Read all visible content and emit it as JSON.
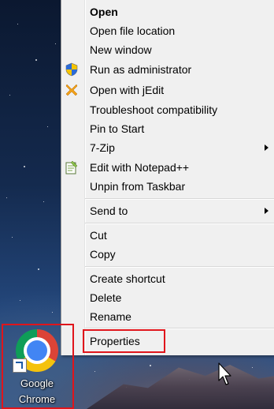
{
  "context_menu": {
    "items": [
      {
        "label": "Open",
        "bold": true,
        "icon": null,
        "submenu": false
      },
      {
        "label": "Open file location",
        "icon": null,
        "submenu": false
      },
      {
        "label": "New window",
        "icon": null,
        "submenu": false
      },
      {
        "label": "Run as administrator",
        "icon": "uac-shield-icon",
        "submenu": false
      },
      {
        "label": "Open with jEdit",
        "icon": "jedit-icon",
        "submenu": false
      },
      {
        "label": "Troubleshoot compatibility",
        "icon": null,
        "submenu": false
      },
      {
        "label": "Pin to Start",
        "icon": null,
        "submenu": false
      },
      {
        "label": "7-Zip",
        "icon": null,
        "submenu": true
      },
      {
        "label": "Edit with Notepad++",
        "icon": "notepad-plus-plus-icon",
        "submenu": false
      },
      {
        "label": "Unpin from Taskbar",
        "icon": null,
        "submenu": false
      },
      {
        "label": "Send to",
        "icon": null,
        "submenu": true
      },
      {
        "label": "Cut",
        "icon": null,
        "submenu": false
      },
      {
        "label": "Copy",
        "icon": null,
        "submenu": false
      },
      {
        "label": "Create shortcut",
        "icon": null,
        "submenu": false
      },
      {
        "label": "Delete",
        "icon": null,
        "submenu": false
      },
      {
        "label": "Rename",
        "icon": null,
        "submenu": false
      },
      {
        "label": "Properties",
        "icon": null,
        "submenu": false,
        "highlighted": true
      }
    ]
  },
  "desktop_shortcut": {
    "label_line1": "Google",
    "label_line2": "Chrome",
    "icon": "chrome-icon",
    "highlighted": true
  },
  "colors": {
    "highlight_border": "#e0151b",
    "menu_background": "#f0f0f0"
  }
}
